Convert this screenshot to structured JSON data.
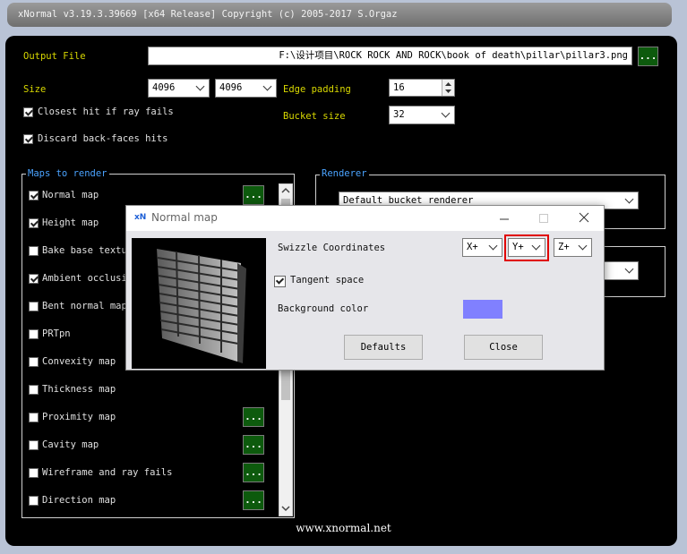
{
  "window": {
    "title": "xNormal v3.19.3.39669 [x64 Release] Copyright (c) 2005-2017 S.Orgaz"
  },
  "output": {
    "label": "Output File",
    "value": "F:\\设计项目\\ROCK ROCK AND ROCK\\book of death\\pillar\\pillar3.png",
    "browse": "..."
  },
  "size": {
    "label": "Size",
    "width": "4096",
    "height": "4096"
  },
  "edge_padding": {
    "label": "Edge padding",
    "value": "16"
  },
  "bucket_size": {
    "label": "Bucket size",
    "value": "32"
  },
  "options": {
    "closest_hit": "Closest hit if ray fails",
    "discard_backfaces": "Discard back-faces hits"
  },
  "maps": {
    "legend": "Maps to render",
    "items": [
      {
        "label": "Normal map",
        "checked": true,
        "has_button": true
      },
      {
        "label": "Height map",
        "checked": true,
        "has_button": false
      },
      {
        "label": "Bake base texture",
        "checked": false,
        "has_button": false
      },
      {
        "label": "Ambient occlusion",
        "checked": true,
        "has_button": false
      },
      {
        "label": "Bent normal map",
        "checked": false,
        "has_button": false
      },
      {
        "label": "PRTpn",
        "checked": false,
        "has_button": false
      },
      {
        "label": "Convexity map",
        "checked": false,
        "has_button": false
      },
      {
        "label": "Thickness map",
        "checked": false,
        "has_button": false
      },
      {
        "label": "Proximity map",
        "checked": false,
        "has_button": true
      },
      {
        "label": "Cavity map",
        "checked": false,
        "has_button": true
      },
      {
        "label": "Wireframe and ray fails",
        "checked": false,
        "has_button": true
      },
      {
        "label": "Direction map",
        "checked": false,
        "has_button": true
      }
    ],
    "button_label": "..."
  },
  "renderer": {
    "legend": "Renderer",
    "value": "Default bucket renderer"
  },
  "dialog": {
    "logo": "xN",
    "title": "Normal map",
    "swizzle_label": "Swizzle Coordinates",
    "swizzle": [
      "X+",
      "Y+",
      "Z+"
    ],
    "tangent_label": "Tangent space",
    "tangent_checked": true,
    "bg_label": "Background color",
    "bg_color": "#8080ff",
    "defaults_label": "Defaults",
    "close_label": "Close"
  },
  "footer": "www.xnormal.net",
  "colors": {
    "accent_yellow": "#d8d800",
    "legend_blue": "#4aa3ff",
    "green_button": "#0d5a0d",
    "highlight_red": "#e00000"
  }
}
